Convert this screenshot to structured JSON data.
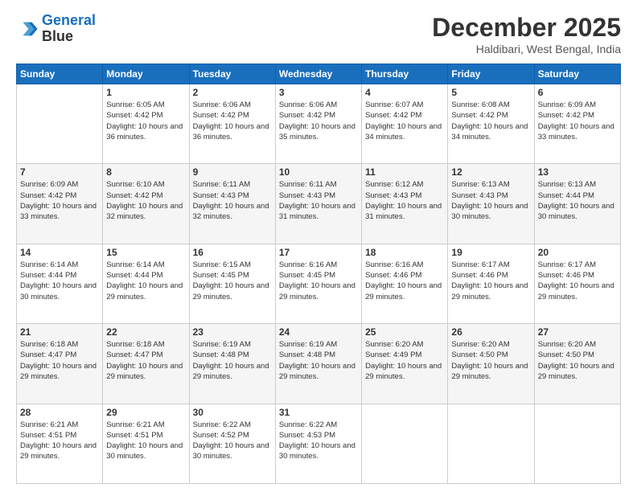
{
  "logo": {
    "line1": "General",
    "line2": "Blue"
  },
  "header": {
    "month": "December 2025",
    "location": "Haldibari, West Bengal, India"
  },
  "weekdays": [
    "Sunday",
    "Monday",
    "Tuesday",
    "Wednesday",
    "Thursday",
    "Friday",
    "Saturday"
  ],
  "weeks": [
    [
      {
        "day": "",
        "info": ""
      },
      {
        "day": "1",
        "info": "Sunrise: 6:05 AM\nSunset: 4:42 PM\nDaylight: 10 hours\nand 36 minutes."
      },
      {
        "day": "2",
        "info": "Sunrise: 6:06 AM\nSunset: 4:42 PM\nDaylight: 10 hours\nand 36 minutes."
      },
      {
        "day": "3",
        "info": "Sunrise: 6:06 AM\nSunset: 4:42 PM\nDaylight: 10 hours\nand 35 minutes."
      },
      {
        "day": "4",
        "info": "Sunrise: 6:07 AM\nSunset: 4:42 PM\nDaylight: 10 hours\nand 34 minutes."
      },
      {
        "day": "5",
        "info": "Sunrise: 6:08 AM\nSunset: 4:42 PM\nDaylight: 10 hours\nand 34 minutes."
      },
      {
        "day": "6",
        "info": "Sunrise: 6:09 AM\nSunset: 4:42 PM\nDaylight: 10 hours\nand 33 minutes."
      }
    ],
    [
      {
        "day": "7",
        "info": "Sunrise: 6:09 AM\nSunset: 4:42 PM\nDaylight: 10 hours\nand 33 minutes."
      },
      {
        "day": "8",
        "info": "Sunrise: 6:10 AM\nSunset: 4:42 PM\nDaylight: 10 hours\nand 32 minutes."
      },
      {
        "day": "9",
        "info": "Sunrise: 6:11 AM\nSunset: 4:43 PM\nDaylight: 10 hours\nand 32 minutes."
      },
      {
        "day": "10",
        "info": "Sunrise: 6:11 AM\nSunset: 4:43 PM\nDaylight: 10 hours\nand 31 minutes."
      },
      {
        "day": "11",
        "info": "Sunrise: 6:12 AM\nSunset: 4:43 PM\nDaylight: 10 hours\nand 31 minutes."
      },
      {
        "day": "12",
        "info": "Sunrise: 6:13 AM\nSunset: 4:43 PM\nDaylight: 10 hours\nand 30 minutes."
      },
      {
        "day": "13",
        "info": "Sunrise: 6:13 AM\nSunset: 4:44 PM\nDaylight: 10 hours\nand 30 minutes."
      }
    ],
    [
      {
        "day": "14",
        "info": "Sunrise: 6:14 AM\nSunset: 4:44 PM\nDaylight: 10 hours\nand 30 minutes."
      },
      {
        "day": "15",
        "info": "Sunrise: 6:14 AM\nSunset: 4:44 PM\nDaylight: 10 hours\nand 29 minutes."
      },
      {
        "day": "16",
        "info": "Sunrise: 6:15 AM\nSunset: 4:45 PM\nDaylight: 10 hours\nand 29 minutes."
      },
      {
        "day": "17",
        "info": "Sunrise: 6:16 AM\nSunset: 4:45 PM\nDaylight: 10 hours\nand 29 minutes."
      },
      {
        "day": "18",
        "info": "Sunrise: 6:16 AM\nSunset: 4:46 PM\nDaylight: 10 hours\nand 29 minutes."
      },
      {
        "day": "19",
        "info": "Sunrise: 6:17 AM\nSunset: 4:46 PM\nDaylight: 10 hours\nand 29 minutes."
      },
      {
        "day": "20",
        "info": "Sunrise: 6:17 AM\nSunset: 4:46 PM\nDaylight: 10 hours\nand 29 minutes."
      }
    ],
    [
      {
        "day": "21",
        "info": "Sunrise: 6:18 AM\nSunset: 4:47 PM\nDaylight: 10 hours\nand 29 minutes."
      },
      {
        "day": "22",
        "info": "Sunrise: 6:18 AM\nSunset: 4:47 PM\nDaylight: 10 hours\nand 29 minutes."
      },
      {
        "day": "23",
        "info": "Sunrise: 6:19 AM\nSunset: 4:48 PM\nDaylight: 10 hours\nand 29 minutes."
      },
      {
        "day": "24",
        "info": "Sunrise: 6:19 AM\nSunset: 4:48 PM\nDaylight: 10 hours\nand 29 minutes."
      },
      {
        "day": "25",
        "info": "Sunrise: 6:20 AM\nSunset: 4:49 PM\nDaylight: 10 hours\nand 29 minutes."
      },
      {
        "day": "26",
        "info": "Sunrise: 6:20 AM\nSunset: 4:50 PM\nDaylight: 10 hours\nand 29 minutes."
      },
      {
        "day": "27",
        "info": "Sunrise: 6:20 AM\nSunset: 4:50 PM\nDaylight: 10 hours\nand 29 minutes."
      }
    ],
    [
      {
        "day": "28",
        "info": "Sunrise: 6:21 AM\nSunset: 4:51 PM\nDaylight: 10 hours\nand 29 minutes."
      },
      {
        "day": "29",
        "info": "Sunrise: 6:21 AM\nSunset: 4:51 PM\nDaylight: 10 hours\nand 30 minutes."
      },
      {
        "day": "30",
        "info": "Sunrise: 6:22 AM\nSunset: 4:52 PM\nDaylight: 10 hours\nand 30 minutes."
      },
      {
        "day": "31",
        "info": "Sunrise: 6:22 AM\nSunset: 4:53 PM\nDaylight: 10 hours\nand 30 minutes."
      },
      {
        "day": "",
        "info": ""
      },
      {
        "day": "",
        "info": ""
      },
      {
        "day": "",
        "info": ""
      }
    ]
  ]
}
